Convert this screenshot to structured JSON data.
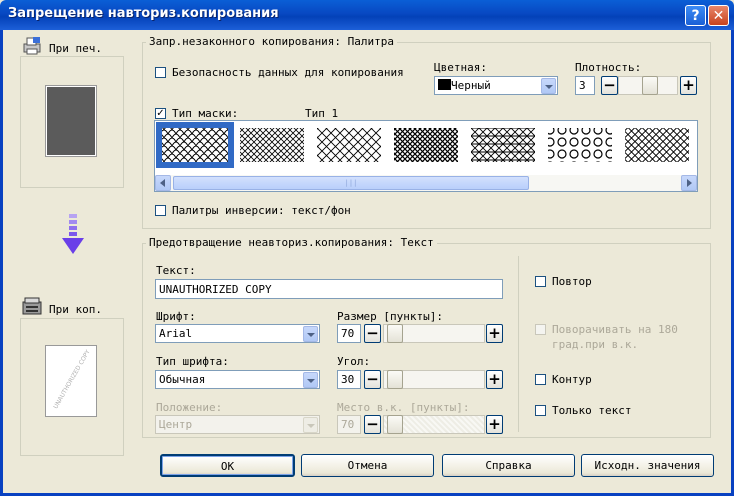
{
  "window": {
    "title": "Запрещение навториз.копирования",
    "help_icon": "?",
    "close_icon": "✕"
  },
  "left_panel": {
    "print_label": "При печ.",
    "copy_label": "При коп.",
    "preview_watermark": "UNAUTHORIZED COPY"
  },
  "palette_group": {
    "title": "Запр.незаконного копирования: Палитра",
    "security_checkbox": {
      "label": "Безопасность данных для копирования",
      "checked": false
    },
    "color": {
      "label": "Цветная:",
      "value": "Черный",
      "swatch": "#000000"
    },
    "density": {
      "label": "Плотность:",
      "value": "3",
      "minus": "−",
      "plus": "+"
    },
    "mask_checkbox": {
      "label": "Тип маски:",
      "checked": true
    },
    "mask_type_value": "Тип 1",
    "patterns": [
      "Тип 1",
      "Тип 2",
      "Тип 3",
      "Тип 4",
      "Тип 5",
      "Тип 6",
      "Тип 7"
    ],
    "scrollbar_grip": "|||",
    "inverse_checkbox": {
      "label": "Палитры инверсии: текст/фон",
      "checked": false
    }
  },
  "text_group": {
    "title": "Предотвращение неавториз.копирования: Текст",
    "text_label": "Текст:",
    "text_value": "UNAUTHORIZED COPY",
    "font_label": "Шрифт:",
    "font_value": "Arial",
    "size_label": "Размер [пункты]:",
    "size_value": "70",
    "style_label": "Тип шрифта:",
    "style_value": "Обычная",
    "angle_label": "Угол:",
    "angle_value": "30",
    "position_label": "Положение:",
    "position_value": "Центр",
    "place_label": "Место в.к. [пункты]:",
    "place_value": "70",
    "minus": "−",
    "plus": "+",
    "repeat_checkbox": {
      "label": "Повтор",
      "checked": false
    },
    "rotate_checkbox": {
      "label": "Поворачивать на 180",
      "label2": "град.при в.к.",
      "checked": false
    },
    "outline_checkbox": {
      "label": "Контур",
      "checked": false
    },
    "textonly_checkbox": {
      "label": "Только текст",
      "checked": false
    }
  },
  "buttons": {
    "ok": "OK",
    "cancel": "Отмена",
    "help": "Справка",
    "defaults": "Исходн. значения"
  }
}
